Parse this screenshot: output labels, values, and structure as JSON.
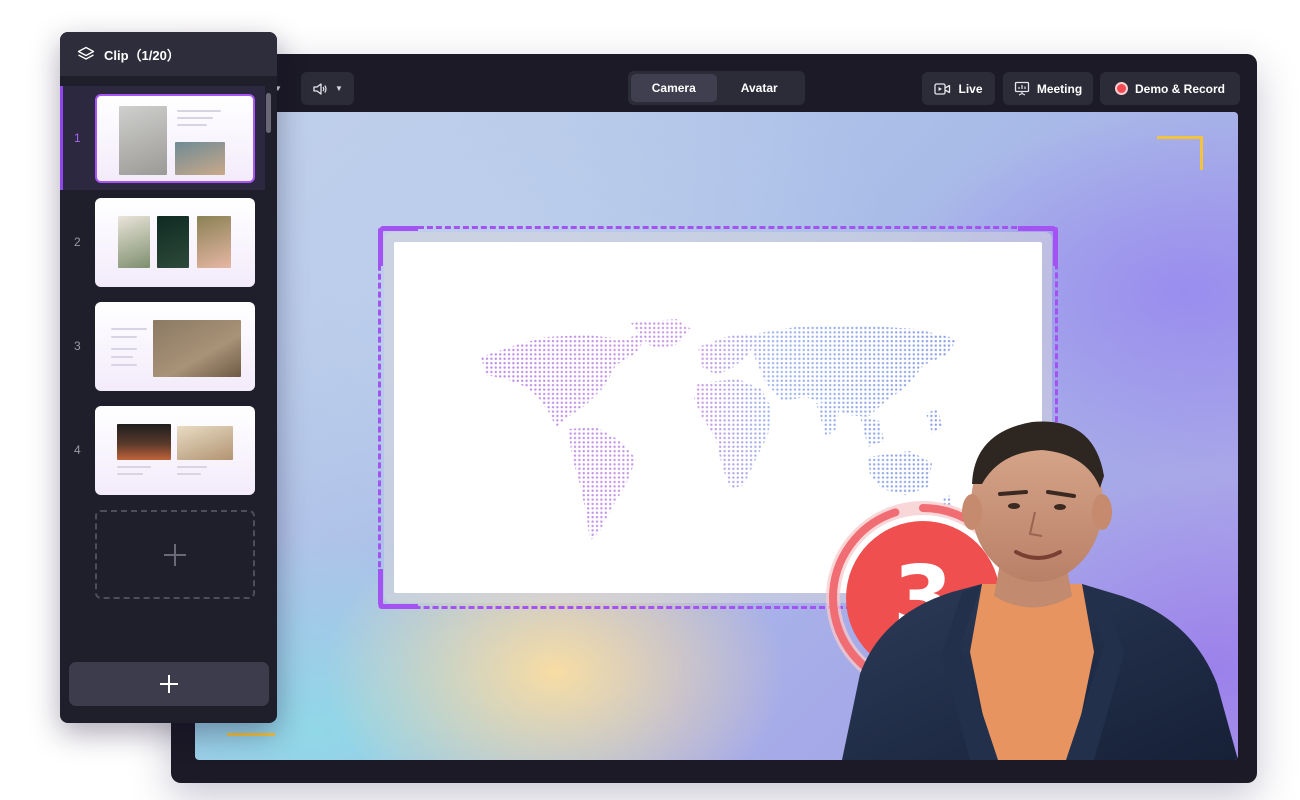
{
  "toolbar": {
    "audio_icon": "speaker-icon",
    "mode_tabs": [
      {
        "label": "Camera",
        "active": true
      },
      {
        "label": "Avatar",
        "active": false
      }
    ],
    "live_label": "Live",
    "meeting_label": "Meeting",
    "record_label": "Demo & Record"
  },
  "stage": {
    "countdown": "3",
    "countdown_progress": 0.95
  },
  "clip_panel": {
    "title": "Clip（1/20）",
    "selected_index": 1,
    "items": [
      {
        "index": "1"
      },
      {
        "index": "2"
      },
      {
        "index": "3"
      },
      {
        "index": "4"
      }
    ]
  },
  "colors": {
    "accent_purple": "#a552f2",
    "record_red": "#f14a52",
    "countdown_red": "#ef4f4f",
    "corner_yellow": "#f5c33b",
    "panel_bg": "#1f1e2b"
  }
}
